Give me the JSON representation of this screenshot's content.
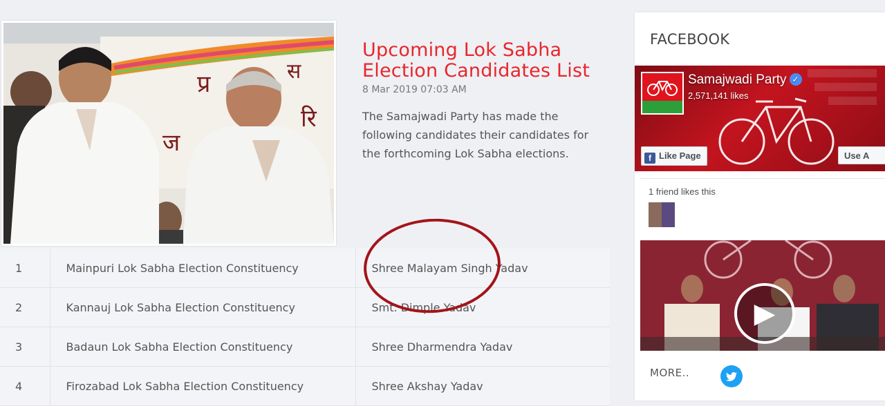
{
  "article": {
    "title": "Upcoming Lok Sabha Election Candidates List",
    "date": "8 Mar 2019 07:03 AM",
    "description": "The Samajwadi Party has made the following candidates their candidates for the forthcoming Lok Sabha elections."
  },
  "candidates": [
    {
      "num": "1",
      "constituency": "Mainpuri Lok Sabha Election Constituency",
      "name": "Shree Malayam Singh Yadav"
    },
    {
      "num": "2",
      "constituency": "Kannauj Lok Sabha Election Constituency",
      "name": "Smt. Dimple Yadav"
    },
    {
      "num": "3",
      "constituency": "Badaun Lok Sabha Election Constituency",
      "name": "Shree Dharmendra Yadav"
    },
    {
      "num": "4",
      "constituency": "Firozabad Lok Sabha Election Constituency",
      "name": "Shree Akshay Yadav"
    }
  ],
  "sidebar": {
    "title": "FACEBOOK",
    "fb": {
      "page_name": "Samajwadi Party",
      "likes": "2,571,141 likes",
      "like_button": "Like Page",
      "use_button": "Use A",
      "friends_text": "1 friend likes this",
      "f_glyph": "f",
      "verified_glyph": "✓"
    },
    "more": "MORE.."
  },
  "colors": {
    "title_red": "#e8262b",
    "circle": "#a3141a",
    "twitter": "#1da1f2",
    "fb_blue": "#3b5998"
  },
  "icons": {
    "play": "play-icon",
    "twitter": "twitter-icon",
    "verified": "verified-badge-icon",
    "facebook": "facebook-f-icon"
  }
}
